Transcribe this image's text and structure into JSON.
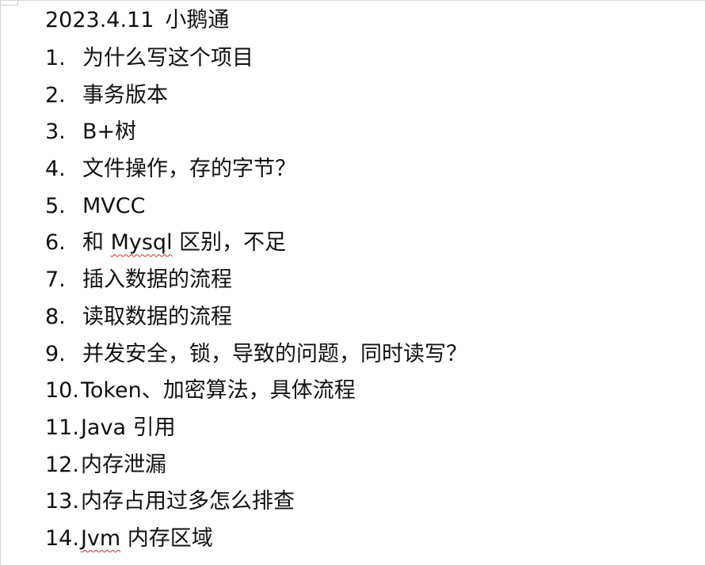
{
  "document": {
    "title_date": "2023.4.11",
    "title_company": "小鹅通",
    "items": [
      {
        "num": "1.",
        "text": "为什么写这个项目"
      },
      {
        "num": "2.",
        "text": "事务版本"
      },
      {
        "num": "3.",
        "text": "B+树"
      },
      {
        "num": "4.",
        "text": "文件操作，存的字节？"
      },
      {
        "num": "5.",
        "text": "MVCC"
      },
      {
        "num": "6.",
        "pre": "和 ",
        "spell": "Mysql",
        "post": " 区别，不足"
      },
      {
        "num": "7.",
        "text": "插入数据的流程"
      },
      {
        "num": "8.",
        "text": "读取数据的流程"
      },
      {
        "num": "9.",
        "text": "并发安全，锁，导致的问题，同时读写？"
      },
      {
        "num": "10.",
        "text": "Token、加密算法，具体流程"
      },
      {
        "num": "11.",
        "text": "Java 引用"
      },
      {
        "num": "12.",
        "text": "内存泄漏"
      },
      {
        "num": "13.",
        "text": "内存占用过多怎么排查"
      },
      {
        "num": "14.",
        "spell": "Jvm",
        "post": " 内存区域"
      }
    ]
  },
  "colors": {
    "text": "#111111",
    "spellcheck_underline": "#d22b2b",
    "frame_border": "#cfcfcf"
  }
}
